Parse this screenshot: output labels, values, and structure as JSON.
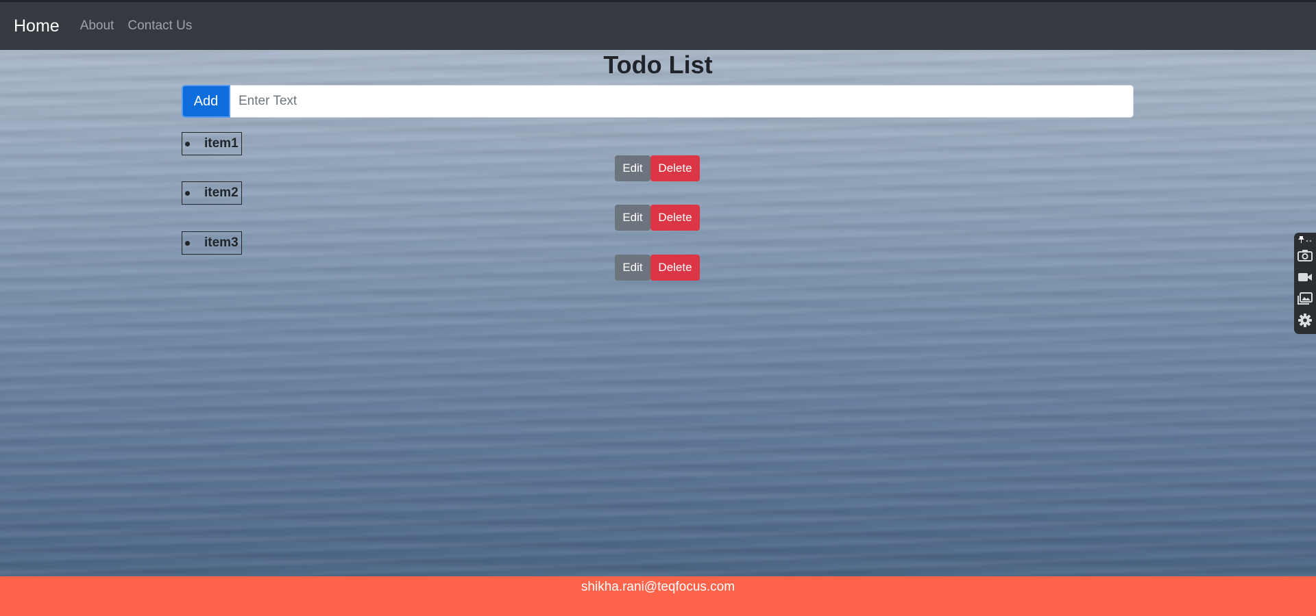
{
  "navbar": {
    "brand": "Home",
    "links": [
      "About",
      "Contact Us"
    ]
  },
  "main": {
    "title": "Todo List",
    "add_label": "Add",
    "input_placeholder": "Enter Text",
    "input_value": "",
    "items": [
      {
        "text": "item1",
        "edit_label": "Edit",
        "delete_label": "Delete"
      },
      {
        "text": "item2",
        "edit_label": "Edit",
        "delete_label": "Delete"
      },
      {
        "text": "item3",
        "edit_label": "Edit",
        "delete_label": "Delete"
      }
    ]
  },
  "side_toolbar": {
    "icons": [
      "pin-icon",
      "camera-icon",
      "video-icon",
      "gallery-icon",
      "gear-icon"
    ]
  },
  "footer": {
    "email": "shikha.rani@teqfocus.com"
  },
  "colors": {
    "navbar": "#343a40",
    "add_button": "#0d6ddc",
    "edit_button": "#6c757d",
    "delete_button": "#dc3545",
    "footer": "#ff644a"
  }
}
